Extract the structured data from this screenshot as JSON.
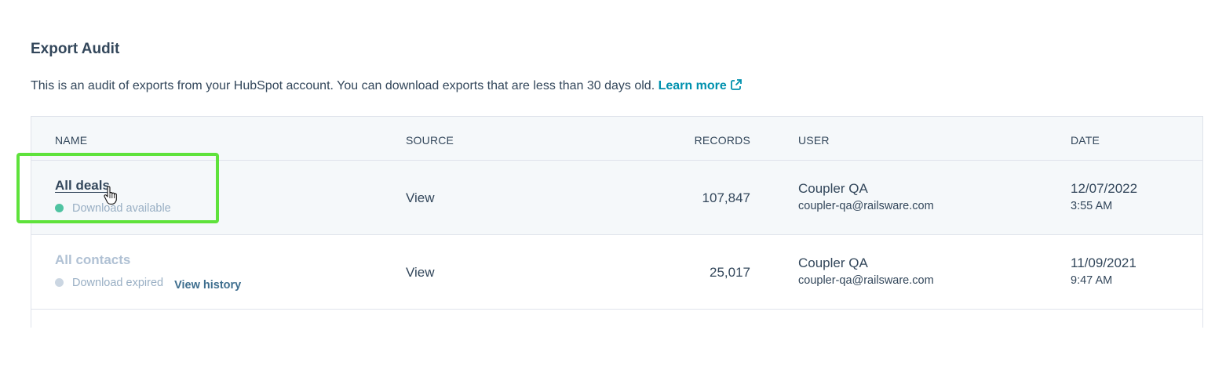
{
  "page": {
    "title": "Export Audit",
    "description": "This is an audit of exports from your HubSpot account. You can download exports that are less than 30 days old.",
    "learn_more_label": "Learn more"
  },
  "table": {
    "headers": {
      "name": "NAME",
      "source": "SOURCE",
      "records": "RECORDS",
      "user": "USER",
      "date": "DATE"
    },
    "rows": [
      {
        "name": "All deals",
        "status": "Download available",
        "source": "View",
        "records": "107,847",
        "user_name": "Coupler QA",
        "user_email": "coupler-qa@railsware.com",
        "date": "12/07/2022",
        "time": "3:55 AM"
      },
      {
        "name": "All contacts",
        "status": "Download expired",
        "history_label": "View history",
        "source": "View",
        "records": "25,017",
        "user_name": "Coupler QA",
        "user_email": "coupler-qa@railsware.com",
        "date": "11/09/2021",
        "time": "9:47 AM"
      }
    ]
  },
  "colors": {
    "link": "#0091ae",
    "available": "#4fc3a1",
    "expired": "#cbd6e2",
    "highlight": "#5ee23b"
  },
  "icons": {
    "external_link": "external-link-icon",
    "cursor": "hand-pointer-icon"
  }
}
